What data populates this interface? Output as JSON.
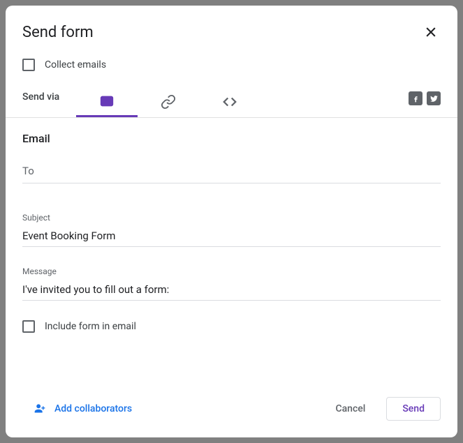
{
  "dialog": {
    "title": "Send form"
  },
  "collect": {
    "label": "Collect emails",
    "checked": false
  },
  "tabs": {
    "send_via_label": "Send via"
  },
  "email": {
    "section_title": "Email",
    "to_label": "To",
    "to_value": "",
    "subject_label": "Subject",
    "subject_value": "Event Booking Form",
    "message_label": "Message",
    "message_value": "I've invited you to fill out a form:",
    "include_label": "Include form in email",
    "include_checked": false
  },
  "footer": {
    "add_collaborators": "Add collaborators",
    "cancel": "Cancel",
    "send": "Send"
  }
}
